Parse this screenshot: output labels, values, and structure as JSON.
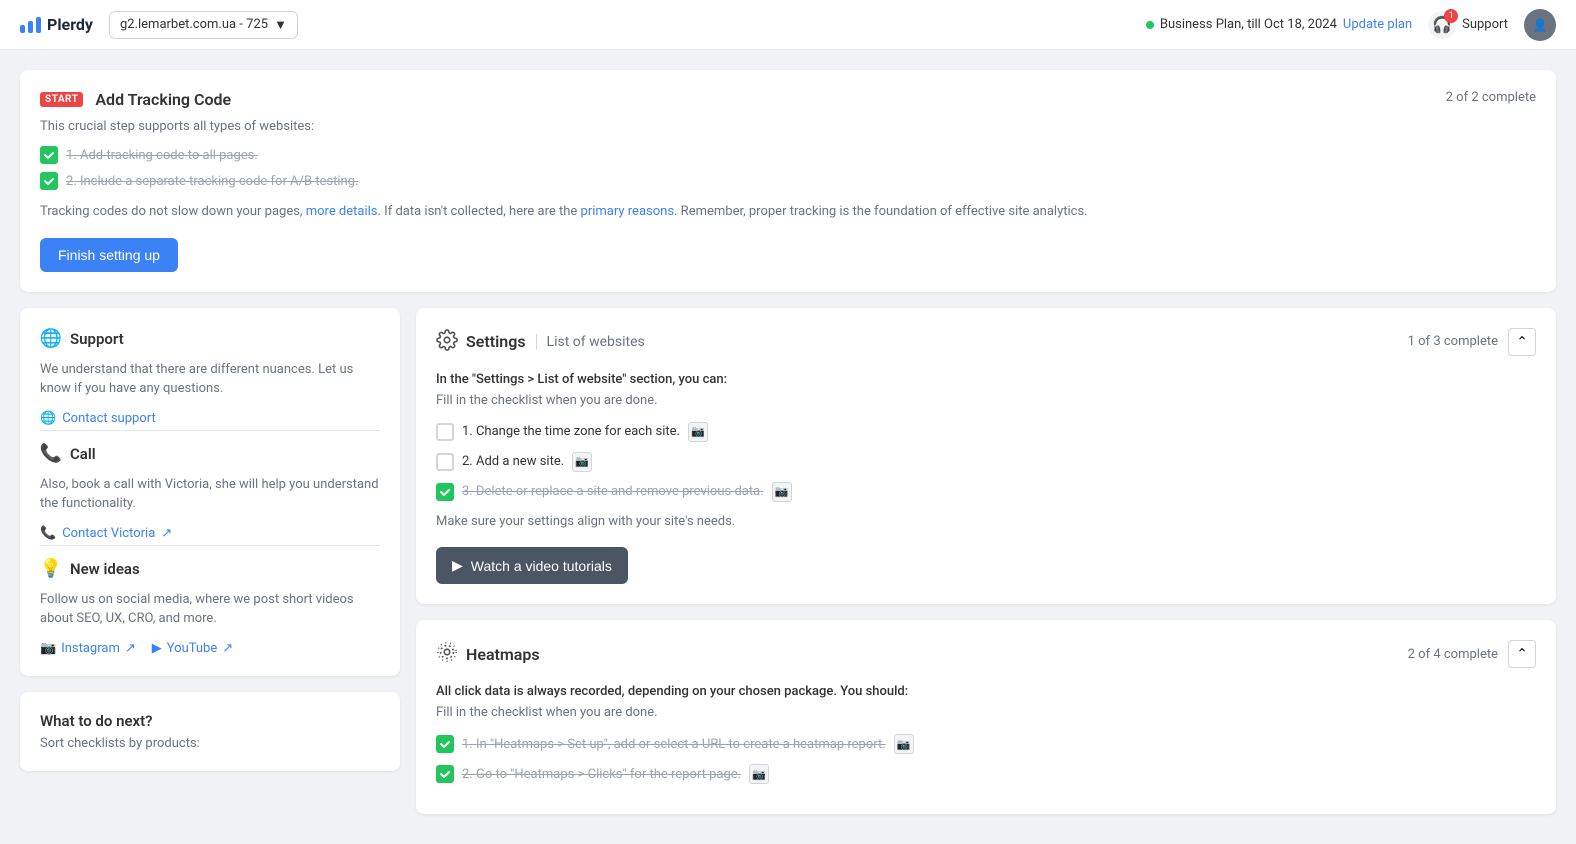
{
  "header": {
    "logo_text": "Plerdy",
    "site_selector": "g2.lemarbet.com.ua - 725",
    "plan_text": "Business Plan, till Oct 18, 2024",
    "update_label": "Update plan",
    "support_label": "Support",
    "support_badge": "1"
  },
  "tracking": {
    "badge": "START",
    "title": "Add Tracking Code",
    "desc": "This crucial step supports all types of websites:",
    "complete_label": "2 of 2 complete",
    "items": [
      {
        "id": 1,
        "text": "Add tracking code to all pages.",
        "done": true
      },
      {
        "id": 2,
        "text": "Include a separate tracking code for A/B testing.",
        "done": true
      }
    ],
    "info_text_before": "Tracking codes do not slow down your pages,",
    "more_details": "more details",
    "info_text_mid": ". If data isn't collected, here are the",
    "primary_reasons": "primary reasons",
    "info_text_after": ". Remember, proper tracking is the foundation of effective site analytics.",
    "finish_btn": "Finish setting up"
  },
  "support_card": {
    "title": "Support",
    "desc": "We understand that there are different nuances. Let us know if you have any questions.",
    "contact_label": "Contact support"
  },
  "call_card": {
    "title": "Call",
    "desc": "Also, book a call with Victoria, she will help you understand the functionality.",
    "contact_label": "Contact Victoria"
  },
  "new_ideas": {
    "title": "New ideas",
    "desc": "Follow us on social media, where we post short videos about SEO, UX, CRO, and more.",
    "instagram_label": "Instagram",
    "youtube_label": "YouTube"
  },
  "what_next": {
    "title": "What to do next?",
    "desc": "Sort checklists by products:"
  },
  "settings": {
    "title": "Settings",
    "subtitle": "List of websites",
    "complete_label": "1 of 3 complete",
    "intro": "In the \"Settings > List of website\" section, you can:",
    "sub_text": "Fill in the checklist when you are done.",
    "items": [
      {
        "id": 1,
        "text": "Change the time zone for each site.",
        "done": false
      },
      {
        "id": 2,
        "text": "Add a new site.",
        "done": false
      },
      {
        "id": 3,
        "text": "Delete or replace a site and remove previous data.",
        "done": true
      }
    ],
    "note": "Make sure your settings align with your site's needs.",
    "watch_btn": "Watch a video tutorials"
  },
  "heatmaps": {
    "title": "Heatmaps",
    "complete_label": "2 of 4 complete",
    "intro": "All click data is always recorded, depending on your chosen package. You should:",
    "sub_text": "Fill in the checklist when you are done.",
    "items": [
      {
        "id": 1,
        "text": "In \"Heatmaps > Set up\", add or select a URL to create a heatmap report.",
        "done": true
      },
      {
        "id": 2,
        "text": "Go to \"Heatmaps > Clicks\" for the report page.",
        "done": true
      }
    ]
  }
}
